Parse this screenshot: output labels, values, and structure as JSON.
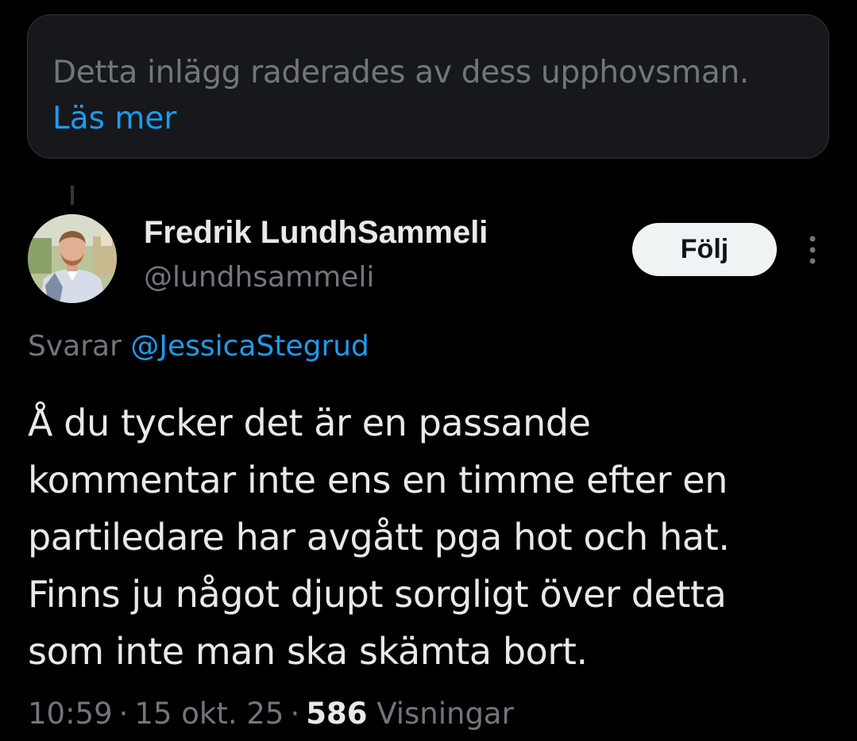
{
  "deleted_notice": {
    "text": "Detta inlägg raderades av dess upphovsman.",
    "link": "Läs mer"
  },
  "tweet": {
    "author": {
      "name": "Fredrik LundhSammeli",
      "handle": "@lundhsammeli"
    },
    "follow_label": "Följ",
    "reply_prefix": "Svarar",
    "reply_to": "@JessicaStegrud",
    "text_lines": [
      "Å du tycker det är en passande",
      "kommentar inte ens en timme efter en",
      "partiledare har avgått pga hot och hat.",
      "Finns ju något djupt sorgligt över detta",
      "som inte man ska skämta bort."
    ],
    "time": "10:59",
    "separator": "·",
    "date": "15 okt. 25",
    "views_count": "586",
    "views_label": "Visningar"
  },
  "colors": {
    "background": "#000000",
    "card": "#16181c",
    "text_primary": "#e7e9ea",
    "text_secondary": "#71767b",
    "accent": "#1d9bf0",
    "button_bg": "#eff3f4"
  },
  "icons": {
    "more": "more-vertical-icon",
    "avatar": "profile-photo"
  }
}
